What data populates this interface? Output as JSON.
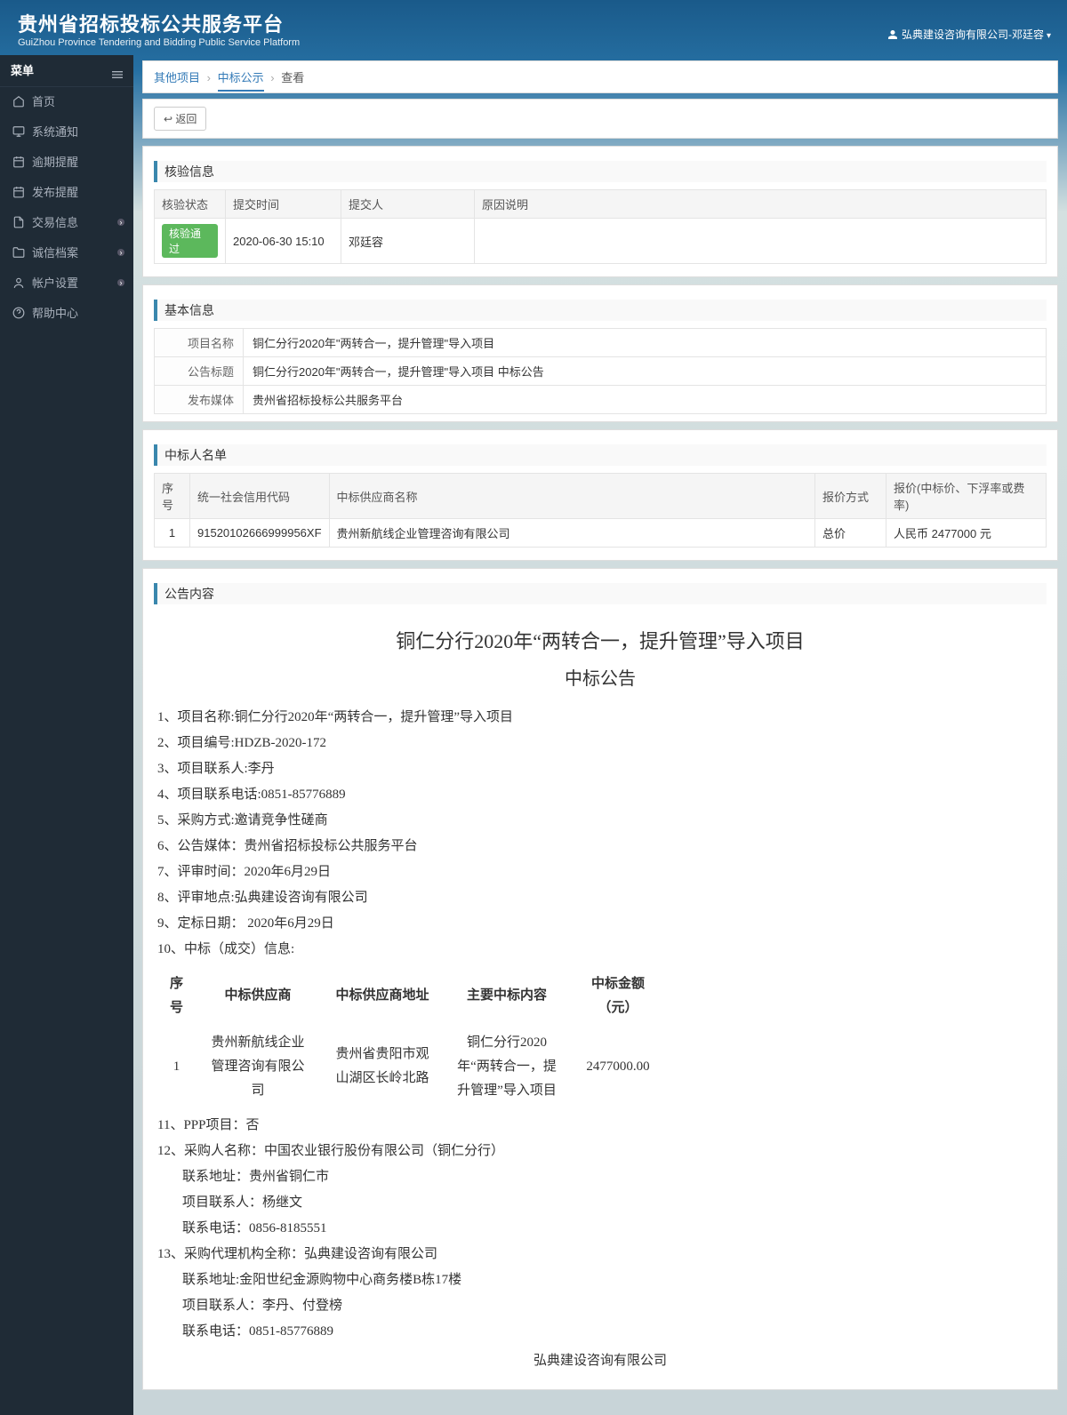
{
  "header": {
    "title_cn": "贵州省招标投标公共服务平台",
    "title_en": "GuiZhou Province Tendering and Bidding Public Service Platform",
    "user_label": "弘典建设咨询有限公司-邓廷容"
  },
  "sidebar": {
    "menu_label": "菜单",
    "items": [
      {
        "label": "首页",
        "icon": "home",
        "has_sub": false
      },
      {
        "label": "系统通知",
        "icon": "monitor",
        "has_sub": false
      },
      {
        "label": "逾期提醒",
        "icon": "calendar",
        "has_sub": false
      },
      {
        "label": "发布提醒",
        "icon": "calendar",
        "has_sub": false
      },
      {
        "label": "交易信息",
        "icon": "file",
        "has_sub": true
      },
      {
        "label": "诚信档案",
        "icon": "folder",
        "has_sub": true
      },
      {
        "label": "帐户设置",
        "icon": "user",
        "has_sub": true
      },
      {
        "label": "帮助中心",
        "icon": "help",
        "has_sub": false
      }
    ]
  },
  "breadcrumb": {
    "level1": "其他项目",
    "level2": "中标公示",
    "level3": "查看"
  },
  "back_label": "返回",
  "sections": {
    "verify_title": "核验信息",
    "verify_headers": [
      "核验状态",
      "提交时间",
      "提交人",
      "原因说明"
    ],
    "verify_row": {
      "status": "核验通过",
      "time": "2020-06-30 15:10",
      "submitter": "邓廷容",
      "reason": ""
    },
    "basic_title": "基本信息",
    "basic_rows": [
      {
        "label": "项目名称",
        "value": "铜仁分行2020年\"两转合一，提升管理\"导入项目"
      },
      {
        "label": "公告标题",
        "value": "铜仁分行2020年\"两转合一，提升管理\"导入项目 中标公告"
      },
      {
        "label": "发布媒体",
        "value": "贵州省招标投标公共服务平台"
      }
    ],
    "winner_title": "中标人名单",
    "winner_headers": [
      "序号",
      "统一社会信用代码",
      "中标供应商名称",
      "报价方式",
      "报价(中标价、下浮率或费率)"
    ],
    "winner_row": {
      "no": "1",
      "code": "91520102666999956XF",
      "name": "贵州新航线企业管理咨询有限公司",
      "method": "总价",
      "price": "人民币 2477000 元"
    },
    "content_title": "公告内容"
  },
  "announce": {
    "title_line1": "铜仁分行2020年“两转合一，提升管理”导入项目",
    "title_line2": "中标公告",
    "lines": [
      "1、项目名称:铜仁分行2020年“两转合一，提升管理”导入项目",
      "2、项目编号:HDZB-2020-172",
      "3、项目联系人:李丹",
      "4、项目联系电话:0851-85776889",
      "5、采购方式:邀请竞争性磋商",
      "6、公告媒体：贵州省招标投标公共服务平台",
      "7、评审时间：2020年6月29日",
      "8、评审地点:弘典建设咨询有限公司",
      "9、定标日期： 2020年6月29日",
      "10、中标（成交）信息:"
    ],
    "inner_headers": [
      "序号",
      "中标供应商",
      "中标供应商地址",
      "主要中标内容",
      "中标金额（元）"
    ],
    "inner_row": {
      "no": "1",
      "supplier": "贵州新航线企业管理咨询有限公司",
      "address": "贵州省贵阳市观山湖区长岭北路",
      "content": "铜仁分行2020年“两转合一，提升管理”导入项目",
      "amount": "2477000.00"
    },
    "lines2": [
      "11、PPP项目：否",
      "12、采购人名称：中国农业银行股份有限公司（铜仁分行）"
    ],
    "buyer_extra": [
      "联系地址：贵州省铜仁市",
      "项目联系人：杨继文",
      "联系电话：0856-8185551"
    ],
    "agent_title": "13、采购代理机构全称：弘典建设咨询有限公司",
    "agent_extra": [
      "联系地址:金阳世纪金源购物中心商务楼B栋17楼",
      "项目联系人：李丹、付登榜",
      "联系电话：0851-85776889"
    ],
    "signature": "弘典建设咨询有限公司"
  }
}
